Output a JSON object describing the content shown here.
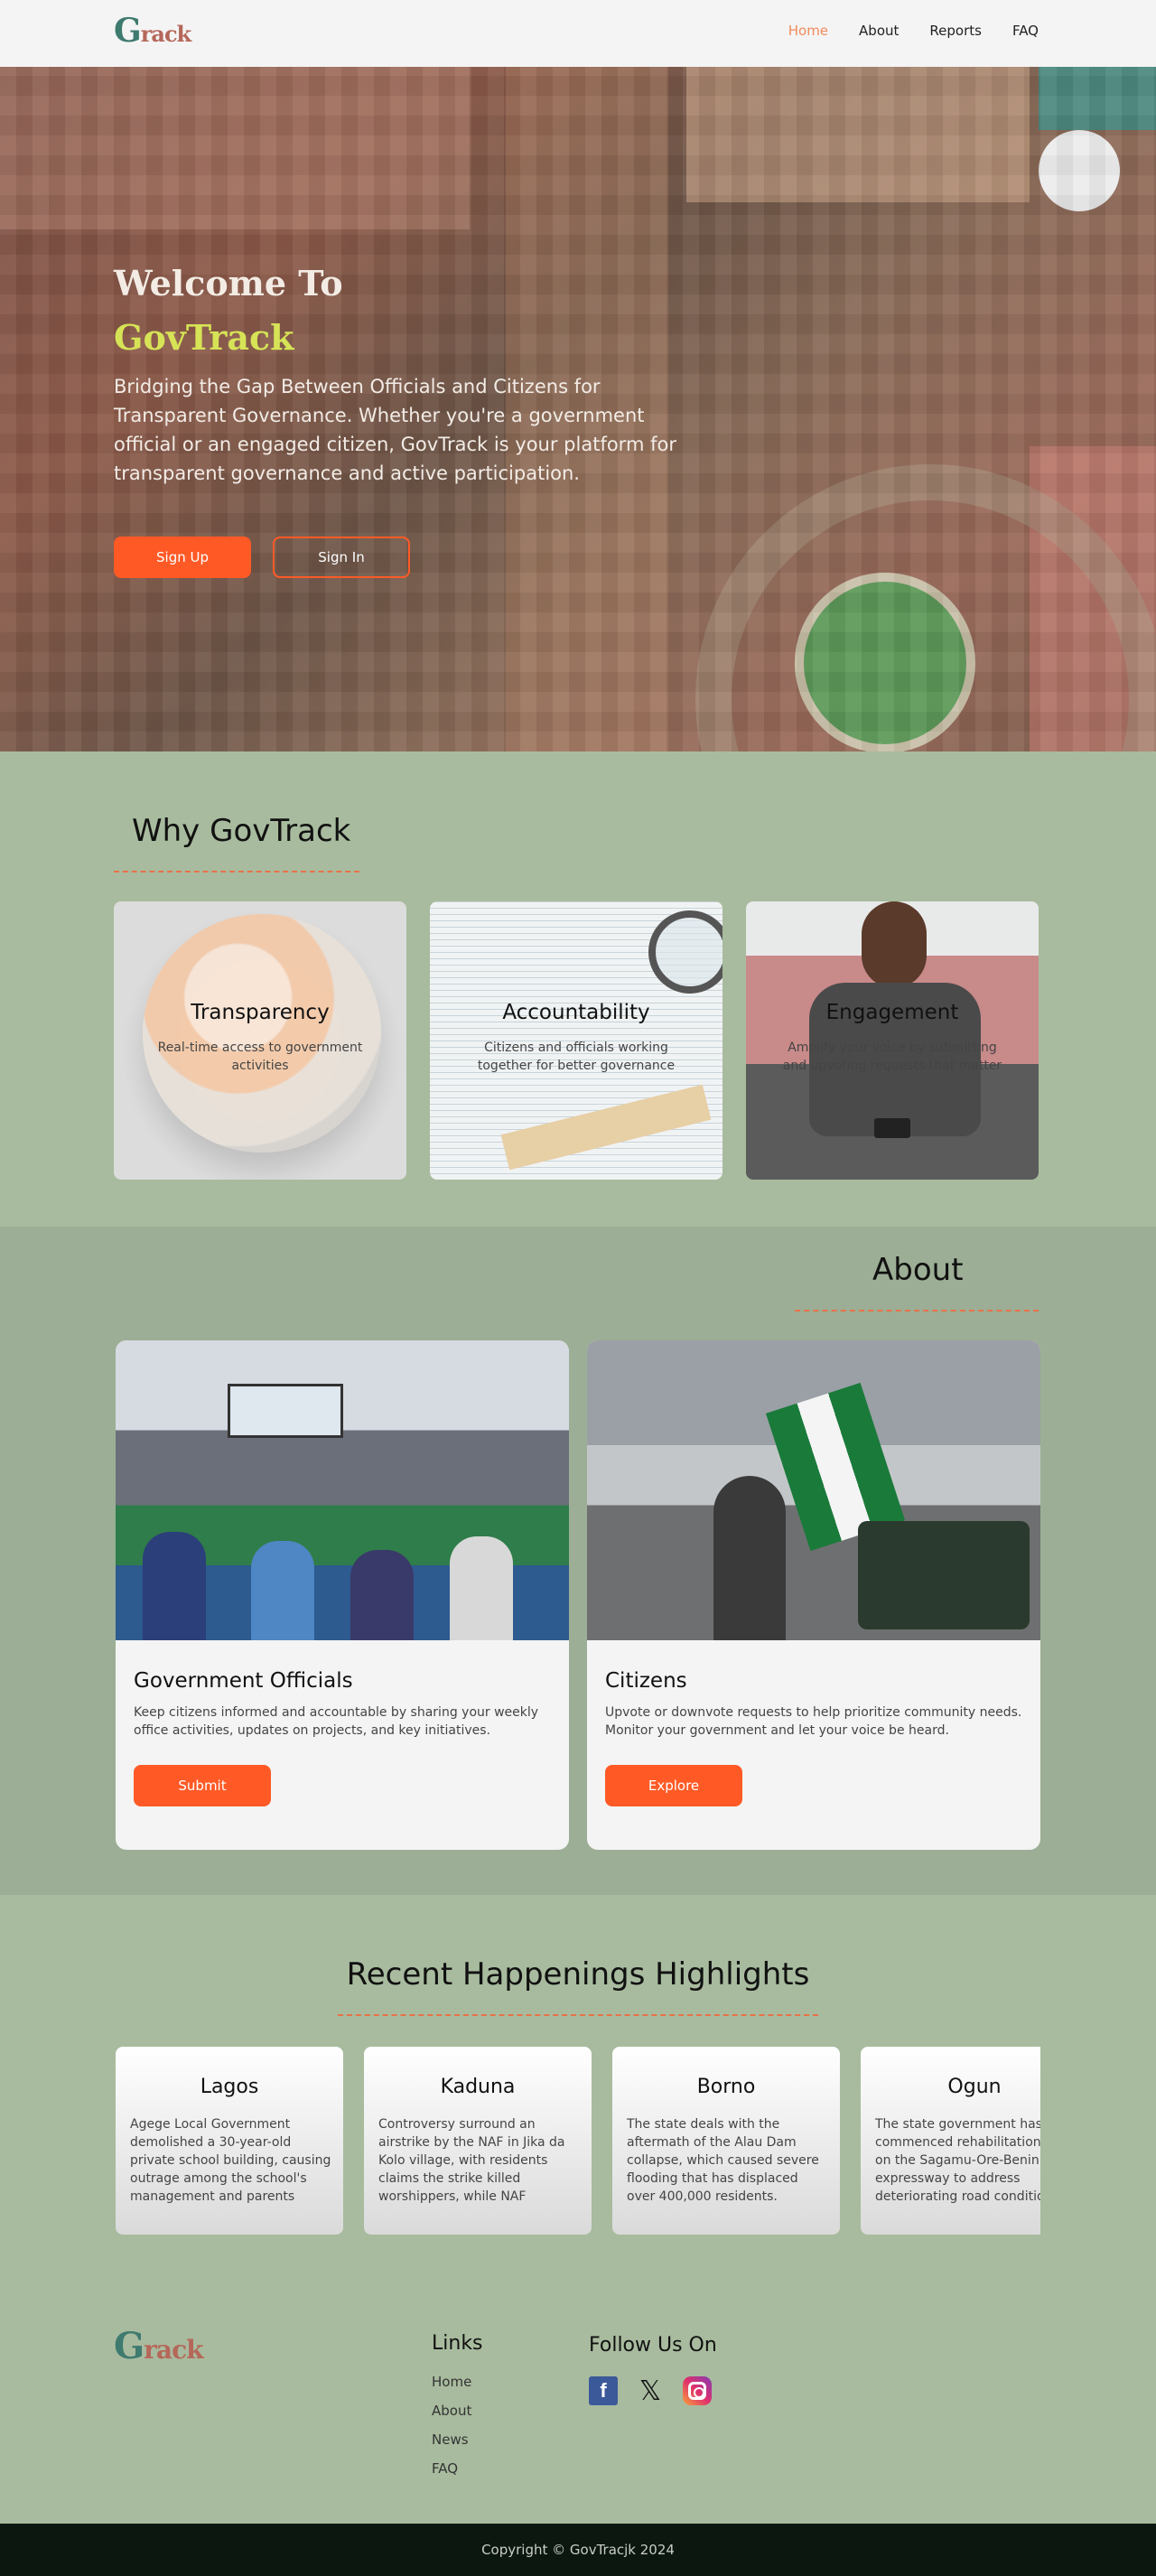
{
  "nav": {
    "logo_g": "G",
    "logo_rest": "rack",
    "links": [
      "Home",
      "About",
      "Reports",
      "FAQ"
    ]
  },
  "hero": {
    "title": "Welcome To",
    "brand": "GovTrack",
    "description": "Bridging the Gap Between Officials and Citizens for Transparent Governance. Whether you're a government official or an engaged citizen, GovTrack is your platform for transparent governance and active participation.",
    "signup_label": "Sign Up",
    "signin_label": "Sign In"
  },
  "why": {
    "title": "Why GovTrack",
    "cards": [
      {
        "title": "Transparency",
        "desc": "Real-time access to government activities"
      },
      {
        "title": "Accountability",
        "desc": "Citizens and officials working together for better governance"
      },
      {
        "title": "Engagement",
        "desc": "Amplify your voice by submitting and upvoting requests that matter"
      }
    ]
  },
  "about": {
    "title": "About",
    "cards": [
      {
        "title": "Government Officials",
        "desc": "Keep citizens informed and accountable by sharing your weekly office activities, updates on projects, and key initiatives.",
        "button": "Submit"
      },
      {
        "title": "Citizens",
        "desc": "Upvote or downvote requests to help prioritize community needs. Monitor your government and let your voice be heard.",
        "button": "Explore"
      }
    ]
  },
  "highlights": {
    "title": "Recent Happenings Highlights",
    "cards": [
      {
        "title": "Lagos",
        "desc": "Agege Local Government demolished a 30-year-old private school building, causing outrage among the school's management and parents"
      },
      {
        "title": "Kaduna",
        "desc": "Controversy surround an airstrike by the NAF in Jika da Kolo village, with residents claims the strike killed worshippers, while NAF"
      },
      {
        "title": "Borno",
        "desc": "The state deals with the aftermath of the Alau Dam collapse, which caused severe flooding that has displaced over 400,000 residents."
      },
      {
        "title": "Ogun",
        "desc": "The state government has commenced rehabilitation work on the Sagamu-Ore-Benin expressway to address deteriorating road conditions"
      }
    ]
  },
  "footer": {
    "logo_g": "G",
    "logo_rest": "rack",
    "links_title": "Links",
    "links": [
      "Home",
      "About",
      "News",
      "FAQ"
    ],
    "follow_title": "Follow Us On",
    "socials": [
      "facebook-icon",
      "x-icon",
      "instagram-icon"
    ],
    "copyright": "Copyright © GovTracjk 2024"
  },
  "colors": {
    "accent": "#ff5a26",
    "page_bg": "#a8bb9e",
    "about_bg": "#9cae95",
    "brand_highlight": "#d6e356",
    "footer_bar": "#0c1710"
  }
}
